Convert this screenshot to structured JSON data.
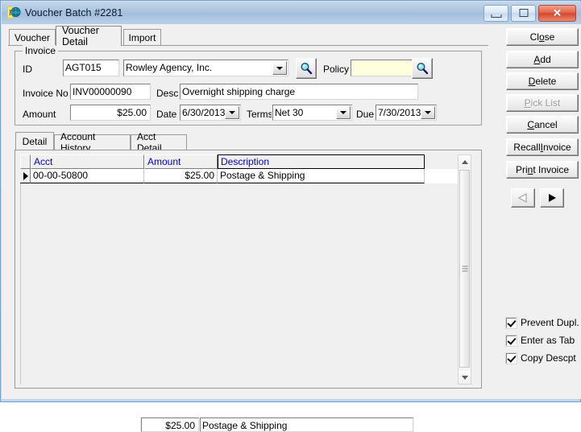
{
  "window": {
    "title": "Voucher Batch #2281",
    "icon": "invoice-globe-icon",
    "minimize_label": "Minimize",
    "maximize_label": "Maximize",
    "close_label": "✕"
  },
  "tabs": [
    {
      "label": "Voucher",
      "active": false
    },
    {
      "label": "Voucher Detail",
      "active": true
    },
    {
      "label": "Import",
      "active": false
    }
  ],
  "invoice": {
    "group_label": "Invoice",
    "id_label": "ID",
    "id_value": "AGT015",
    "agency_value": "Rowley Agency, Inc.",
    "agency_search_icon": "magnifier-icon",
    "policy_label": "Policy",
    "policy_value": "",
    "policy_search_icon": "magnifier-icon",
    "invoice_no_label": "Invoice No.",
    "invoice_no_value": "INV00000090",
    "desc_label": "Desc.",
    "desc_value": "Overnight shipping charge",
    "amount_label": "Amount",
    "amount_value": "$25.00",
    "date_label": "Date",
    "date_value": "6/30/2013",
    "terms_label": "Terms",
    "terms_value": "Net 30",
    "due_label": "Due",
    "due_value": "7/30/2013"
  },
  "inner_tabs": [
    {
      "label": "Detail",
      "active": true
    },
    {
      "label": "Account History",
      "active": false
    },
    {
      "label": "Acct Detail",
      "active": false
    }
  ],
  "grid": {
    "columns": [
      "Acct",
      "Amount",
      "Description"
    ],
    "rows": [
      {
        "indicator": "current-row-arrow",
        "acct": "00-00-50800",
        "amount": "$25.00",
        "description": "Postage & Shipping"
      }
    ]
  },
  "footer": {
    "amount": "$25.00",
    "description": "Postage & Shipping"
  },
  "buttons": [
    {
      "name": "close",
      "pre": "Cl",
      "accel": "o",
      "post": "se",
      "disabled": false
    },
    {
      "name": "add",
      "pre": "",
      "accel": "A",
      "post": "dd",
      "disabled": false
    },
    {
      "name": "delete",
      "pre": "",
      "accel": "D",
      "post": "elete",
      "disabled": false
    },
    {
      "name": "pick-list",
      "pre": "",
      "accel": "P",
      "post": "ick List",
      "disabled": true
    },
    {
      "name": "cancel",
      "pre": "",
      "accel": "C",
      "post": "ancel",
      "disabled": false
    },
    {
      "name": "recall-invoice",
      "pre": "Recall ",
      "accel": "I",
      "post": "nvoice",
      "disabled": false
    },
    {
      "name": "print-invoice",
      "pre": "Pri",
      "accel": "n",
      "post": "t Invoice",
      "disabled": false
    }
  ],
  "nav": {
    "prev_icon": "triangle-left-icon",
    "next_icon": "triangle-right-icon",
    "prev_disabled": true,
    "next_disabled": false
  },
  "checkboxes": [
    {
      "name": "prevent-dupl",
      "label": "Prevent Dupl.",
      "checked": true
    },
    {
      "name": "enter-as-tab",
      "label": "Enter as Tab",
      "checked": true
    },
    {
      "name": "copy-descpt",
      "label": "Copy Descpt",
      "checked": true
    }
  ],
  "colors": {
    "titlebar": "#a9c3de",
    "face": "#f0f0f0",
    "grid_header_text": "#0000cc",
    "policy_field": "#ffffdd",
    "close_button": "#d2472c"
  }
}
